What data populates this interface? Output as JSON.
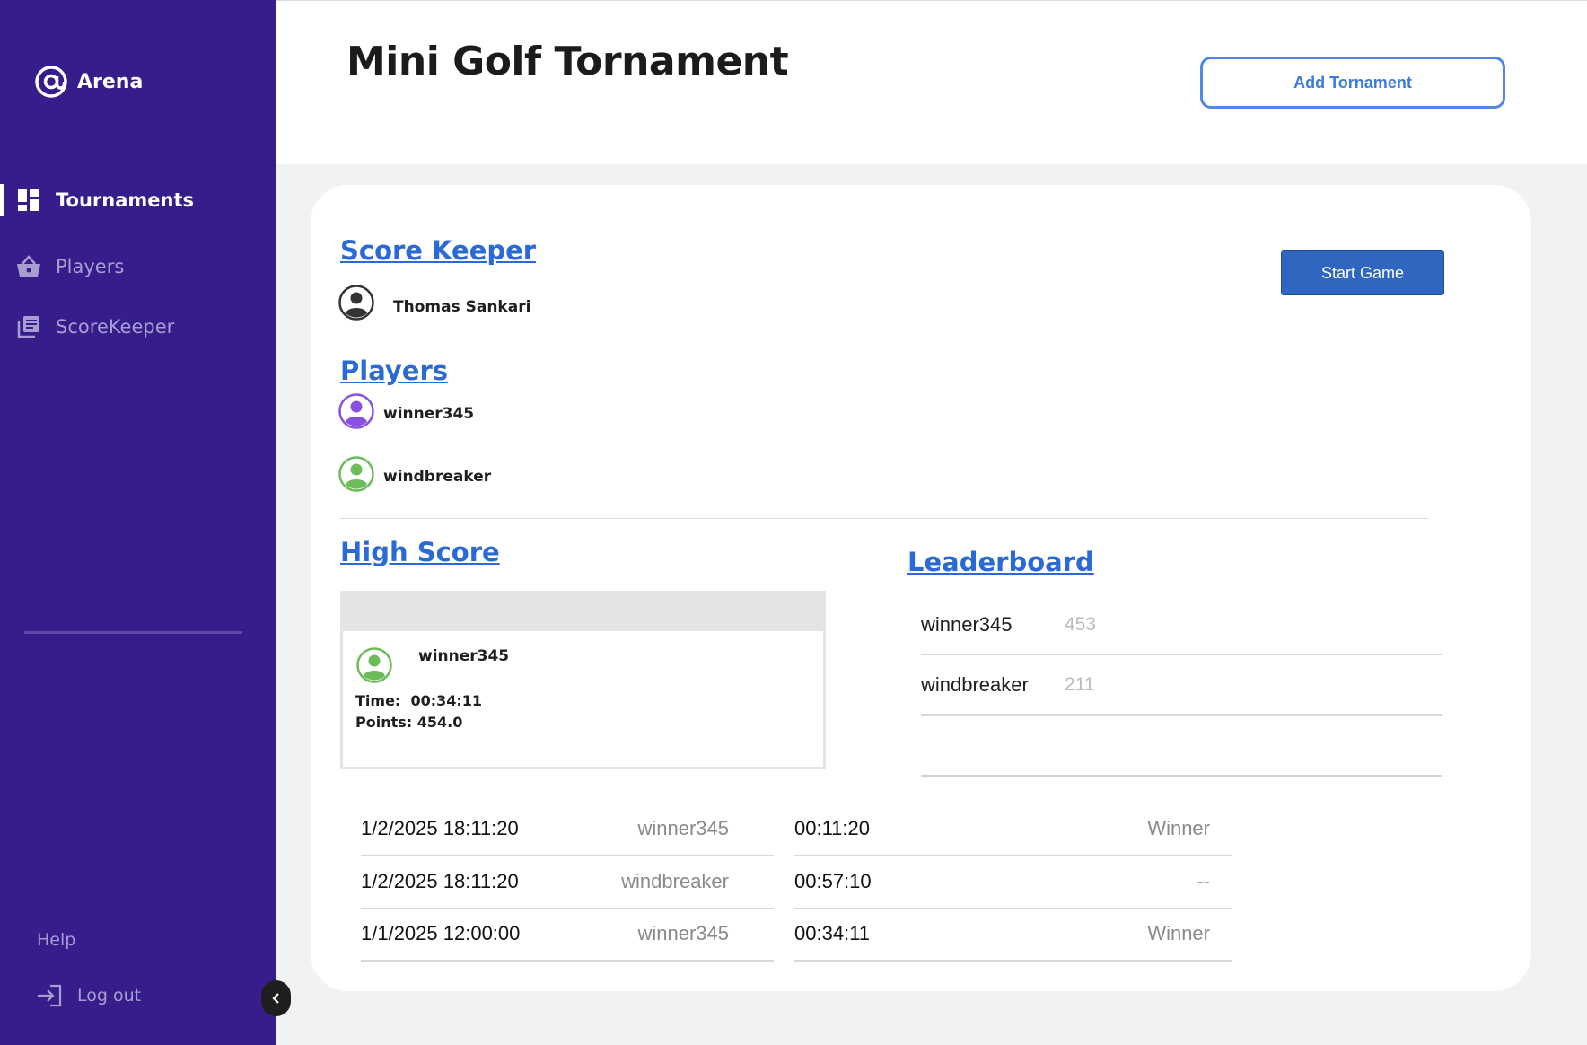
{
  "app": {
    "name": "Arena"
  },
  "sidebar": {
    "items": [
      {
        "label": "Tournaments",
        "icon": "dashboard-icon",
        "active": true
      },
      {
        "label": "Players",
        "icon": "basket-icon",
        "active": false
      },
      {
        "label": "ScoreKeeper",
        "icon": "library-icon",
        "active": false
      }
    ],
    "help": "Help",
    "logout": "Log out"
  },
  "header": {
    "title": "Mini Golf Tornament",
    "add_button": "Add Tornament"
  },
  "score_keeper": {
    "title": "Score Keeper",
    "name": "Thomas Sankari",
    "start_button": "Start Game"
  },
  "players": {
    "title": "Players",
    "list": [
      {
        "name": "winner345",
        "avatar_color": "#8a4fe0"
      },
      {
        "name": "windbreaker",
        "avatar_color": "#6dbb5a"
      }
    ]
  },
  "high_score": {
    "title": "High Score",
    "name": "winner345",
    "time_label": "Time:",
    "time": "00:34:11",
    "points_label": "Points:",
    "points": "454.0"
  },
  "leaderboard": {
    "title": "Leaderboard",
    "rows": [
      {
        "name": "winner345",
        "score": "453"
      },
      {
        "name": "windbreaker",
        "score": "211"
      }
    ]
  },
  "history": [
    {
      "date": "1/2/2025 18:11:20",
      "player": "winner345",
      "time": "00:11:20",
      "result": "Winner"
    },
    {
      "date": "1/2/2025 18:11:20",
      "player": "windbreaker",
      "time": "00:57:10",
      "result": "--"
    },
    {
      "date": "1/1/2025 12:00:00",
      "player": "winner345",
      "time": "00:34:11",
      "result": "Winner"
    }
  ],
  "colors": {
    "sidebar": "#371d8c",
    "link": "#2a6ad6",
    "button": "#2e66c0",
    "outline_button": "#4d87e8"
  }
}
